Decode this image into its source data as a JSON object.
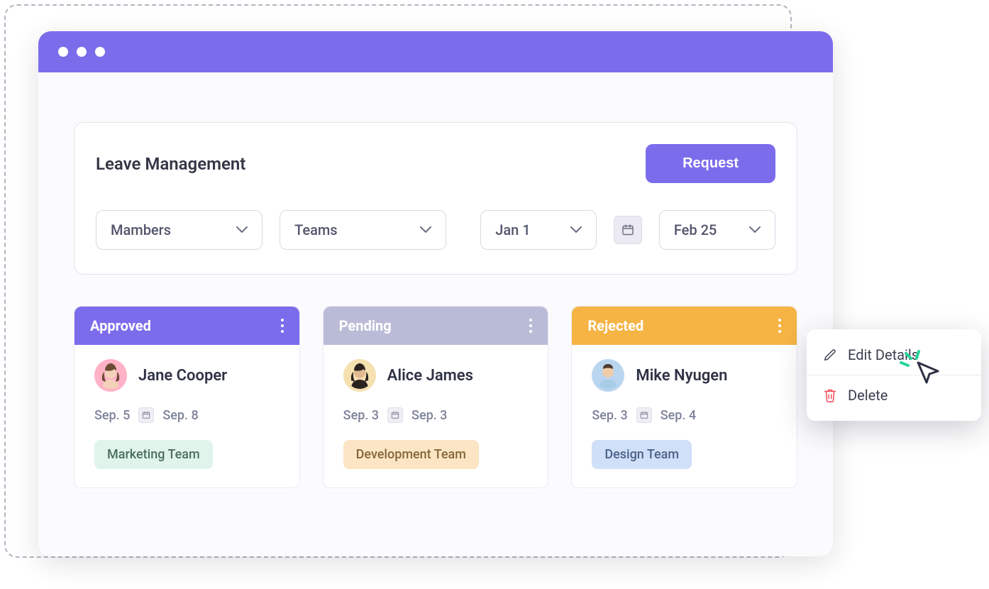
{
  "page": {
    "title": "Leave Management",
    "request_button": "Request"
  },
  "filters": {
    "members": "Mambers",
    "teams": "Teams",
    "date_from": "Jan 1",
    "date_to": "Feb 25"
  },
  "columns": {
    "approved": {
      "title": "Approved",
      "header_bg": "#7b6cec",
      "card": {
        "name": "Jane Cooper",
        "avatar_bg": "#ffb2c6",
        "avatar_face": "#f2d2b8",
        "avatar_hair": "#6b4a34",
        "date_from": "Sep. 5",
        "date_to": "Sep. 8",
        "team": "Marketing Team",
        "tag_bg": "#e0f4eb",
        "tag_color": "#4c6e5f"
      }
    },
    "pending": {
      "title": "Pending",
      "header_bg": "#babcd7",
      "card": {
        "name": "Alice James",
        "avatar_bg": "#f5e0b0",
        "avatar_face": "#e2b892",
        "avatar_hair": "#2b2320",
        "date_from": "Sep. 3",
        "date_to": "Sep. 3",
        "team": "Development Team",
        "tag_bg": "#fbe5c4",
        "tag_color": "#86663b"
      }
    },
    "rejected": {
      "title": "Rejected",
      "header_bg": "#f6b445",
      "card": {
        "name": "Mike Nyugen",
        "avatar_bg": "#b9d5ef",
        "avatar_face": "#f0cba7",
        "avatar_hair": "#4d3a2d",
        "date_from": "Sep. 3",
        "date_to": "Sep. 4",
        "team": "Design Team",
        "tag_bg": "#cfe0f8",
        "tag_color": "#4d6288"
      }
    }
  },
  "popover": {
    "edit": "Edit Details",
    "delete": "Delete"
  }
}
